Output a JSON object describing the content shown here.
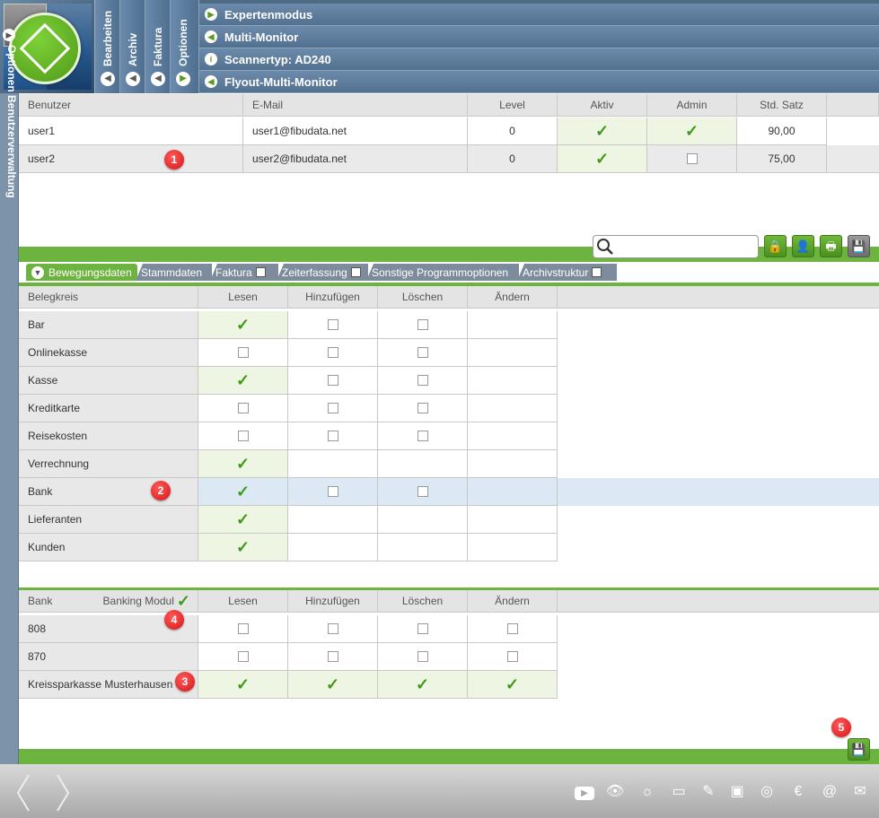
{
  "header": {
    "vtabs": [
      "Bearbeiten",
      "Archiv",
      "Faktura",
      "Optionen"
    ],
    "menu": [
      {
        "label": "Expertenmodus",
        "icon": "play-right-icon"
      },
      {
        "label": "Multi-Monitor",
        "icon": "play-left-icon"
      },
      {
        "label": "Scannertyp: AD240",
        "icon": "info-icon"
      },
      {
        "label": "Flyout-Multi-Monitor",
        "icon": "play-left-icon"
      }
    ]
  },
  "sidebar": {
    "label": "Optionen  Benutzerverwaltung"
  },
  "users": {
    "columns": [
      "Benutzer",
      "E-Mail",
      "Level",
      "Aktiv",
      "Admin",
      "Std. Satz"
    ],
    "rows": [
      {
        "name": "user1",
        "email": "user1@fibudata.net",
        "level": "0",
        "aktiv": true,
        "admin": true,
        "rate": "90,00"
      },
      {
        "name": "user2",
        "email": "user2@fibudata.net",
        "level": "0",
        "aktiv": true,
        "admin": false,
        "rate": "75,00"
      }
    ]
  },
  "tabs": [
    {
      "label": "Bewegungsdaten",
      "active": true,
      "checkbox": false
    },
    {
      "label": "Stammdaten",
      "active": false,
      "checkbox": false
    },
    {
      "label": "Faktura",
      "active": false,
      "checkbox": true
    },
    {
      "label": "Zeiterfassung",
      "active": false,
      "checkbox": true
    },
    {
      "label": "Sonstige Programmoptionen",
      "active": false,
      "checkbox": false
    },
    {
      "label": "Archivstruktur",
      "active": false,
      "checkbox": true
    }
  ],
  "belegkreis": {
    "columns": [
      "Belegkreis",
      "Lesen",
      "Hinzufügen",
      "Löschen",
      "Ändern"
    ],
    "rows": [
      {
        "label": "Bar",
        "lesen": true,
        "hinz": false,
        "losch": false
      },
      {
        "label": "Onlinekasse",
        "lesen": false,
        "hinz": false,
        "losch": false
      },
      {
        "label": "Kasse",
        "lesen": true,
        "hinz": false,
        "losch": false
      },
      {
        "label": "Kreditkarte",
        "lesen": false,
        "hinz": false,
        "losch": false
      },
      {
        "label": "Reisekosten",
        "lesen": false,
        "hinz": false,
        "losch": false
      },
      {
        "label": "Verrechnung",
        "lesen": true,
        "hinz": null,
        "losch": null
      },
      {
        "label": "Bank",
        "lesen": true,
        "hinz": false,
        "losch": false
      },
      {
        "label": "Lieferanten",
        "lesen": true,
        "hinz": null,
        "losch": null
      },
      {
        "label": "Kunden",
        "lesen": true,
        "hinz": null,
        "losch": null
      }
    ]
  },
  "bank": {
    "columns": [
      "Bank",
      "Lesen",
      "Hinzufügen",
      "Löschen",
      "Ändern"
    ],
    "banking_modul_label": "Banking Modul",
    "rows": [
      {
        "label": "808",
        "lesen": false,
        "hinz": false,
        "losch": false,
        "aend": false
      },
      {
        "label": "870",
        "lesen": false,
        "hinz": false,
        "losch": false,
        "aend": false
      },
      {
        "label": "Kreissparkasse Musterhausen",
        "lesen": true,
        "hinz": true,
        "losch": true,
        "aend": true
      }
    ]
  },
  "badges": [
    "1",
    "2",
    "3",
    "4",
    "5"
  ],
  "colors": {
    "accent": "#6db33f",
    "header": "#5a7898",
    "badge": "#d51414"
  }
}
